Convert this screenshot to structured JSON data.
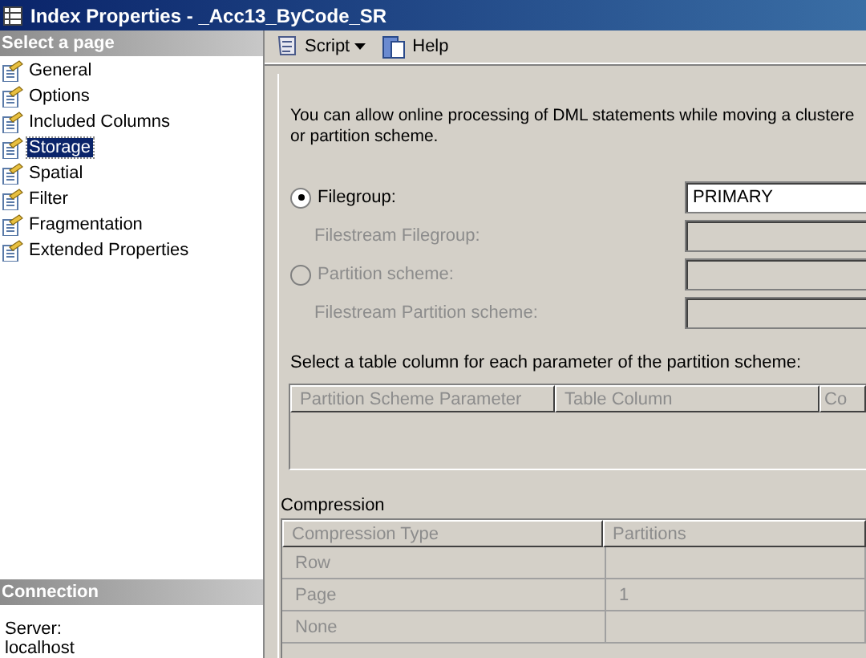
{
  "window": {
    "title": "Index Properties - _Acc13_ByCode_SR"
  },
  "sidebar": {
    "header": "Select a page",
    "items": [
      {
        "label": "General",
        "selected": false
      },
      {
        "label": "Options",
        "selected": false
      },
      {
        "label": "Included Columns",
        "selected": false
      },
      {
        "label": "Storage",
        "selected": true
      },
      {
        "label": "Spatial",
        "selected": false
      },
      {
        "label": "Filter",
        "selected": false
      },
      {
        "label": "Fragmentation",
        "selected": false
      },
      {
        "label": "Extended Properties",
        "selected": false
      }
    ]
  },
  "connection": {
    "header": "Connection",
    "label": "Server:",
    "value": "localhost"
  },
  "toolbar": {
    "script": "Script",
    "help": "Help"
  },
  "intro": [
    "You can allow online processing of DML statements while moving a clustere",
    "or partition scheme."
  ],
  "options": [
    {
      "kind": "radio",
      "label": "Filegroup:",
      "selected": true,
      "disabled": false,
      "value": "PRIMARY"
    },
    {
      "kind": "field",
      "label": "Filestream Filegroup:",
      "disabled": true
    },
    {
      "kind": "radio",
      "label": "Partition scheme:",
      "selected": false,
      "disabled": true
    },
    {
      "kind": "field",
      "label": "Filestream Partition scheme:",
      "disabled": true
    }
  ],
  "partition_prompt": "Select a table column for each parameter of the partition scheme:",
  "partition_table": {
    "columns": [
      "Partition Scheme Parameter",
      "Table Column",
      "Co"
    ]
  },
  "compression": {
    "title": "Compression",
    "columns": [
      "Compression Type",
      "Partitions"
    ],
    "rows": [
      {
        "type": "Row"
      },
      {
        "type": "Page",
        "partitions": "1"
      },
      {
        "type": "None"
      }
    ]
  }
}
